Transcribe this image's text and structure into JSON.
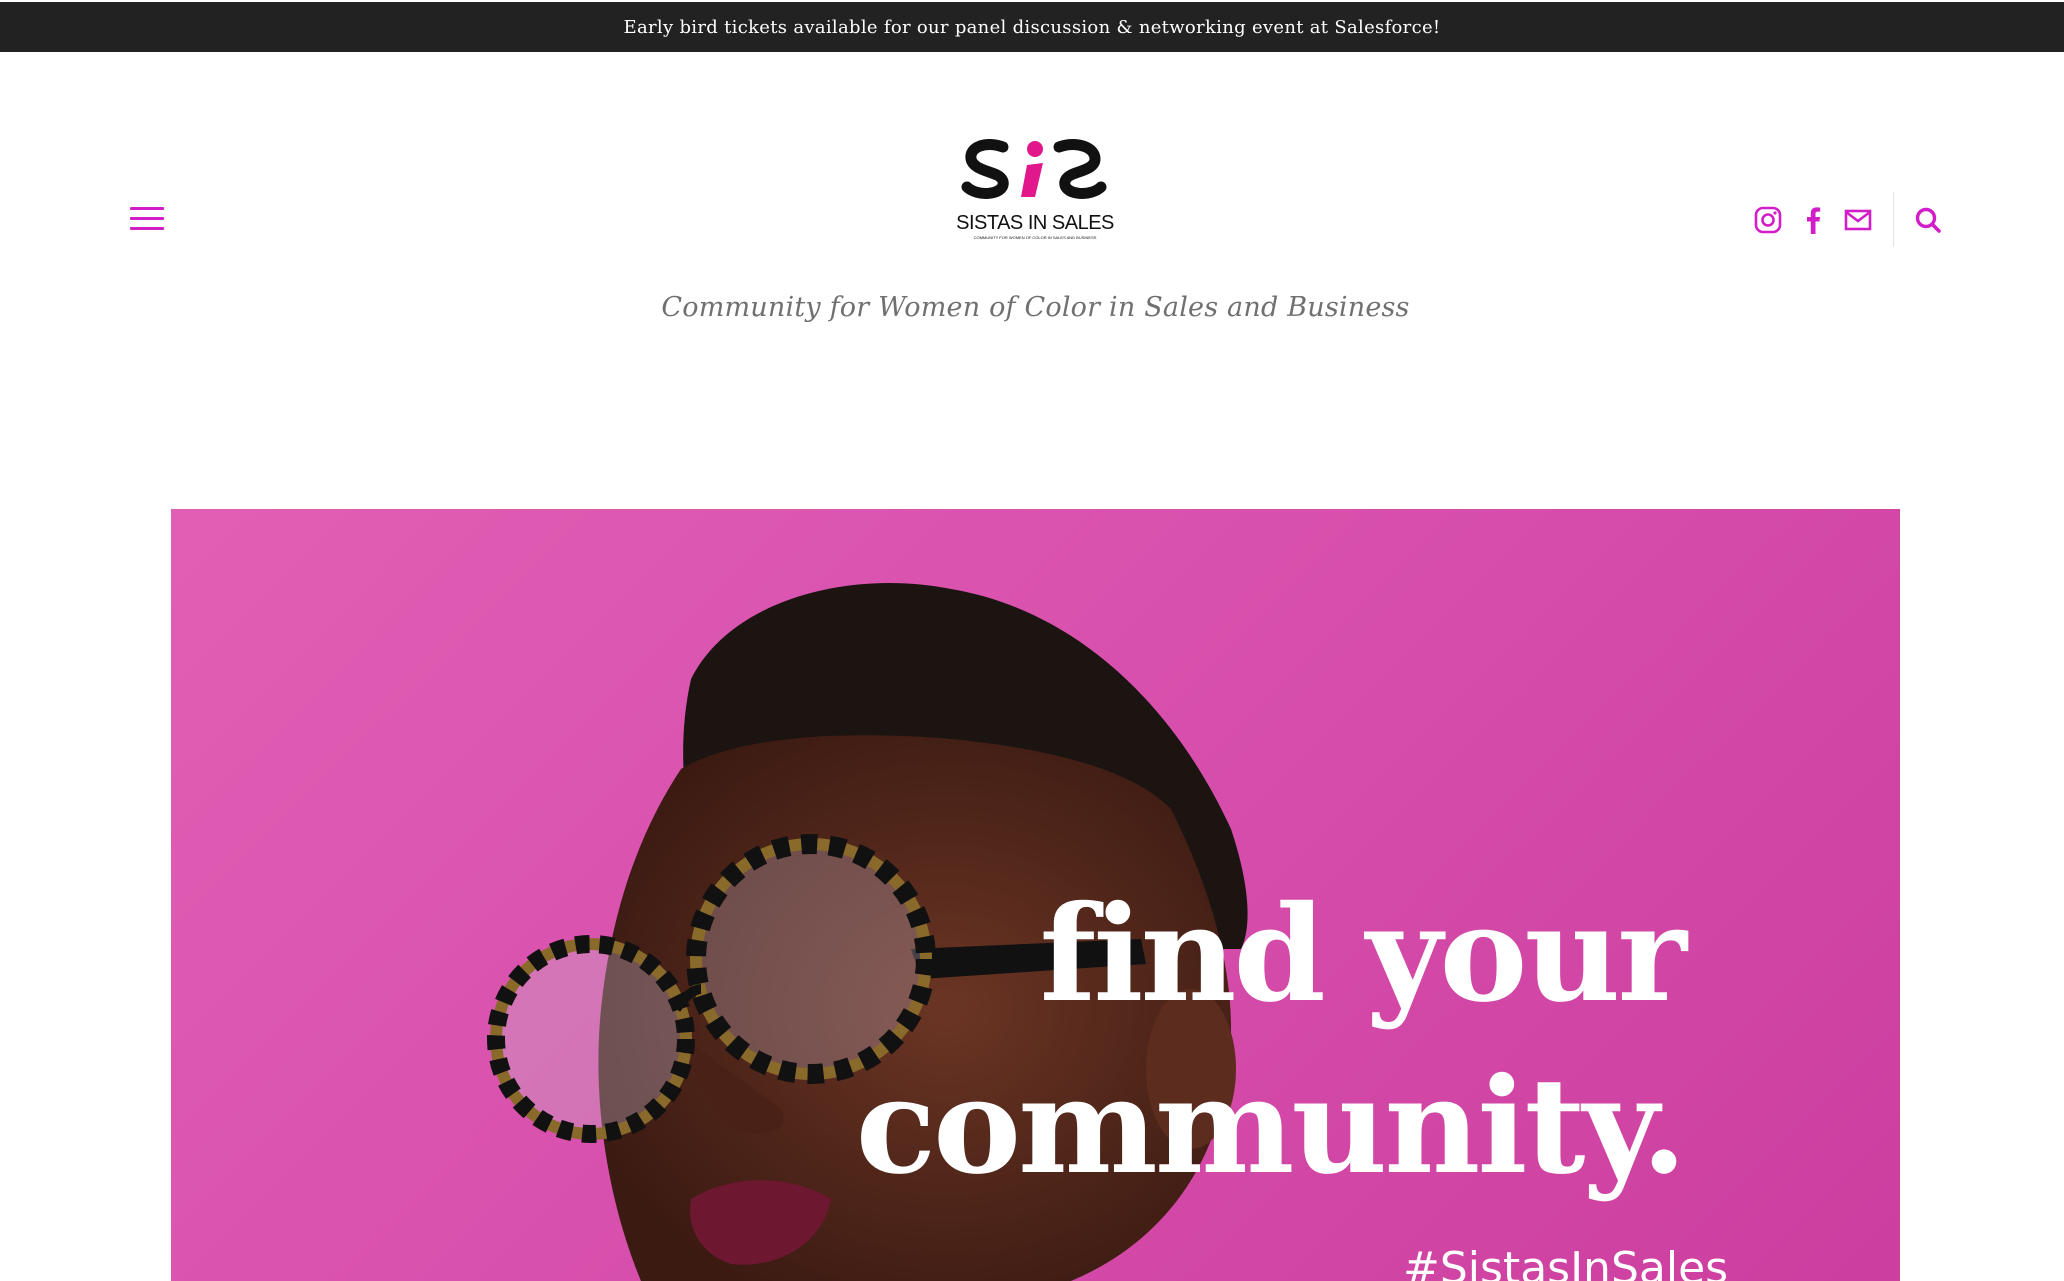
{
  "announcement": {
    "text": "Early bird tickets available for our panel discussion & networking event at Salesforce!"
  },
  "header": {
    "logo": {
      "mark": "SiS",
      "name": "SISTAS IN SALES",
      "subtext": "COMMUNITY FOR WOMEN OF COLOR IN SALES AND BUSINESS"
    },
    "tagline": "Community for Women of Color in Sales and Business",
    "menu_icon": "hamburger-menu-icon",
    "social_icons": [
      "instagram-icon",
      "facebook-icon",
      "email-icon"
    ],
    "search_icon": "search-icon"
  },
  "hero": {
    "headline_line1": "find your",
    "headline_line2": "community.",
    "hashtag": "#SistasInSales"
  },
  "colors": {
    "accent": "#d21ec8",
    "announcement_bg": "#222222",
    "hero_bg": "#d850ad",
    "tagline": "#707070"
  }
}
